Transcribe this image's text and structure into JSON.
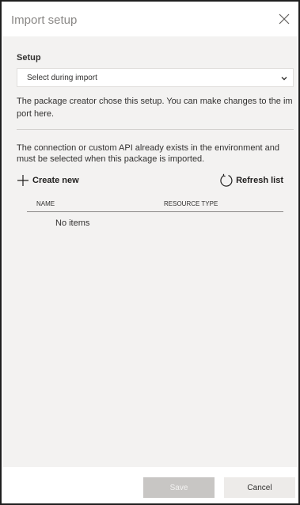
{
  "dialog": {
    "title": "Import setup",
    "close_icon": "close-icon"
  },
  "setup": {
    "label": "Setup",
    "selected_option": "Select during import",
    "description": "The package creator chose this setup. You can make changes to the import here."
  },
  "connection": {
    "description": "The connection or custom API already exists in the environment and must be selected when this package is imported.",
    "create_label": "Create new",
    "refresh_label": "Refresh list"
  },
  "table": {
    "columns": [
      "NAME",
      "RESOURCE TYPE"
    ],
    "empty_text": "No items"
  },
  "footer": {
    "save_label": "Save",
    "cancel_label": "Cancel"
  },
  "colors": {
    "panel_bg": "#f3f2f1",
    "save_disabled_bg": "#c8c6c4",
    "cancel_bg": "#edebe9"
  }
}
